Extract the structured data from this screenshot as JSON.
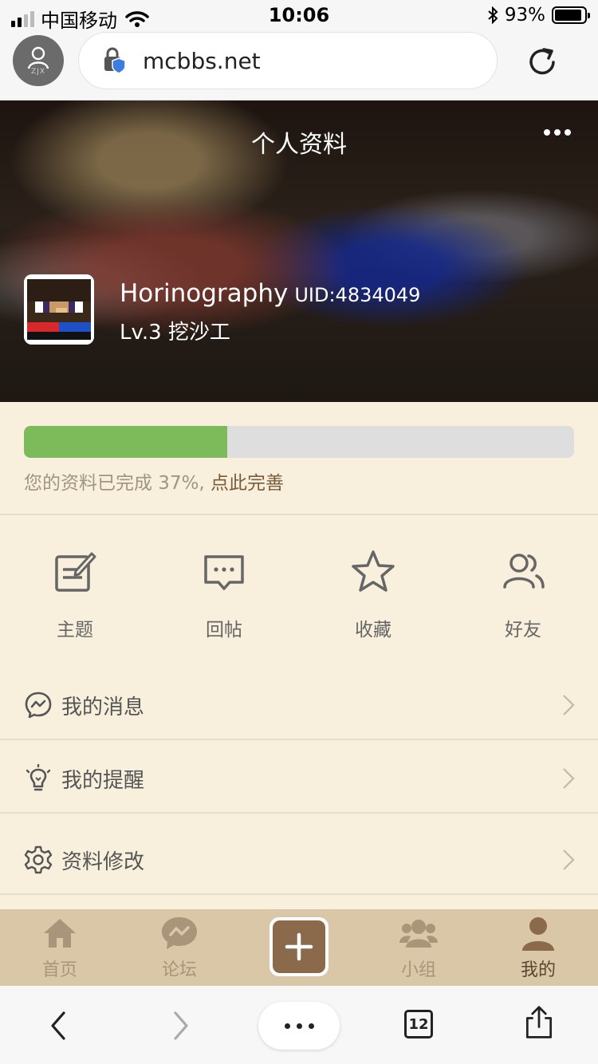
{
  "status_bar": {
    "carrier": "中国移动",
    "time": "10:06",
    "battery": "93%",
    "battery_level": 0.93,
    "icons": [
      "signal-icon",
      "wifi-icon",
      "bluetooth-icon",
      "battery-icon"
    ]
  },
  "browser": {
    "url": "mcbbs.net",
    "profile_initials": "ZJX",
    "tab_count": "12"
  },
  "header": {
    "title": "个人资料",
    "username": "Horinography",
    "uid": "UID:4834049",
    "level": "Lv.3 挖沙工"
  },
  "profile_progress": {
    "percent": 37,
    "text": "您的资料已完成 37%,",
    "link": " 点此完善"
  },
  "quick_actions": [
    {
      "label": "主题",
      "icon": "edit-icon"
    },
    {
      "label": "回帖",
      "icon": "comment-icon"
    },
    {
      "label": "收藏",
      "icon": "star-icon"
    },
    {
      "label": "好友",
      "icon": "friends-icon"
    }
  ],
  "menu": [
    {
      "label": "我的消息",
      "icon": "message-icon"
    },
    {
      "label": "我的提醒",
      "icon": "bulb-icon"
    },
    {
      "label": "资料修改",
      "icon": "settings-icon"
    }
  ],
  "tabbar": [
    {
      "label": "首页",
      "icon": "home-icon",
      "active": false
    },
    {
      "label": "论坛",
      "icon": "forum-icon",
      "active": false
    },
    {
      "label": "小组",
      "icon": "group-icon",
      "active": false
    },
    {
      "label": "我的",
      "icon": "user-icon",
      "active": true
    }
  ],
  "colors": {
    "accent": "#8b6a4b",
    "progress": "#7dba5a",
    "background": "#f8f0dc",
    "tabbar": "#d9c7a8"
  }
}
